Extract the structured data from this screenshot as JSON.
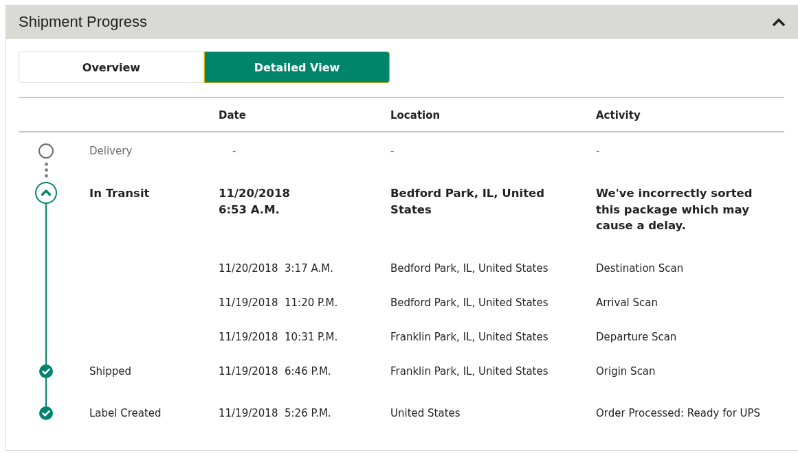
{
  "panel": {
    "title": "Shipment Progress",
    "expanded": true
  },
  "view_tabs": [
    {
      "label": "Overview",
      "selected": false
    },
    {
      "label": "Detailed View",
      "selected": true
    }
  ],
  "table": {
    "columns": [
      "Date",
      "Location",
      "Activity"
    ],
    "rows": [
      {
        "kind": "pending",
        "status": "Delivery",
        "date": "-",
        "location": "-",
        "activity": "-"
      },
      {
        "kind": "current",
        "status": "In Transit",
        "date": "11/20/2018 6:53 A.M.",
        "location": "Bedford Park, IL, United States",
        "activity": "We've incorrectly sorted this package which may cause a delay."
      },
      {
        "kind": "scan",
        "date": "11/20/2018  3:17 A.M.",
        "location": "Bedford Park, IL, United States",
        "activity": "Destination Scan"
      },
      {
        "kind": "scan",
        "date": "11/19/2018  11:20 P.M.",
        "location": "Bedford Park, IL, United States",
        "activity": "Arrival Scan"
      },
      {
        "kind": "scan",
        "date": "11/19/2018  10:31 P.M.",
        "location": "Franklin Park, IL, United States",
        "activity": "Departure Scan"
      },
      {
        "kind": "done",
        "status": "Shipped",
        "date": "11/19/2018  6:46 P.M.",
        "location": "Franklin Park, IL, United States",
        "activity": "Origin Scan"
      },
      {
        "kind": "done",
        "status": "Label Created",
        "date": "11/19/2018  5:26 P.M.",
        "location": "United States",
        "activity": "Order Processed: Ready for UPS"
      }
    ]
  }
}
